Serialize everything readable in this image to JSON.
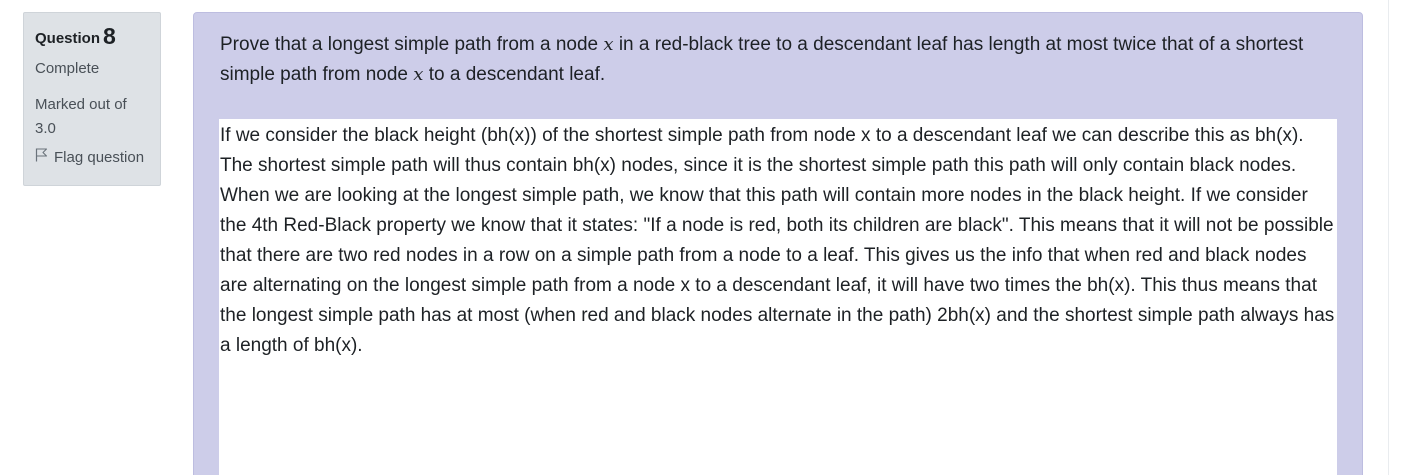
{
  "question": {
    "label": "Question",
    "number": "8",
    "state": "Complete",
    "grade": "Marked out of 3.0",
    "flag_label": "Flag question"
  },
  "question_text": {
    "part1": "Prove that a longest simple path from a node",
    "var1": "x",
    "part2": "in a red-black tree to a descendant leaf has length at most twice that of a shortest simple path from node",
    "var2": "x",
    "part3": "to a descendant leaf."
  },
  "answer_text": "If we consider the black height (bh(x)) of the shortest simple path from node x to a descendant leaf we can describe this as bh(x). The shortest simple path will thus contain bh(x) nodes, since it is the shortest simple path this path will only contain black nodes. When we are looking at the longest simple path, we know that this path will contain more nodes in the black height. If we consider the 4th Red-Black property we know that it states: \"If a node is red, both its children are black\". This means that it will not be possible that there are two red nodes in a row on a simple path from a node to a leaf. This gives us the info that when red and black nodes are alternating on the longest simple path from a node x to a descendant leaf, it will have two times the bh(x). This thus means that the longest simple path has at most (when red and black nodes alternate in the path) 2bh(x) and the shortest simple path always has a length of bh(x).",
  "colors": {
    "info_bg": "#dee2e6",
    "formulation_bg": "#cdcde9",
    "text": "#1d2125",
    "muted": "#495057"
  },
  "icons": {
    "flag": "flag-icon"
  }
}
